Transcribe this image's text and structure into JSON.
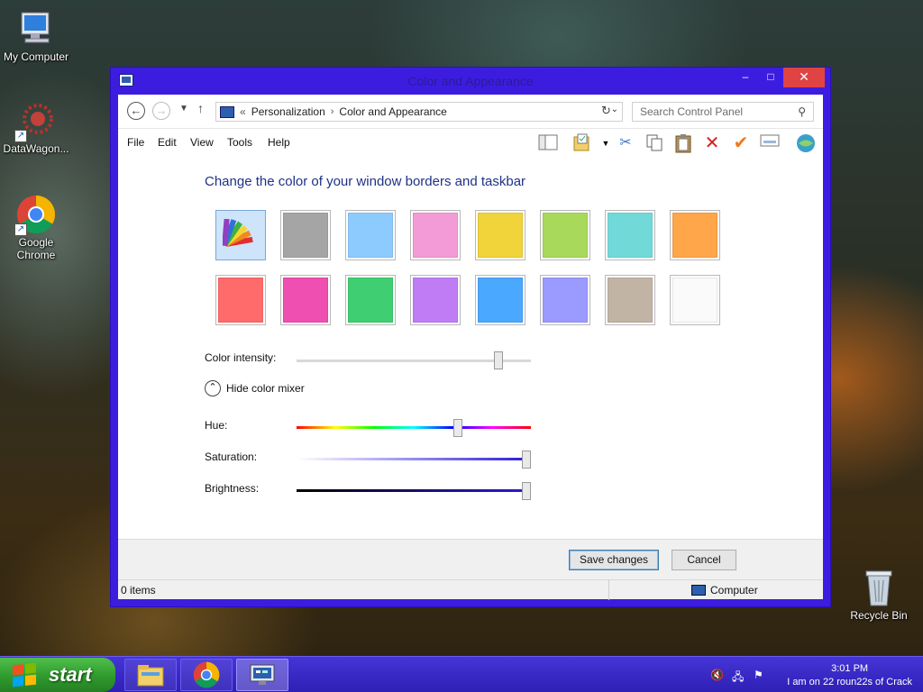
{
  "desktop": {
    "icons": [
      {
        "label": "My Computer",
        "icon": "my-computer-icon"
      },
      {
        "label": "DataWagon...",
        "icon": "datawagon-icon"
      },
      {
        "label": "Google Chrome",
        "icon": "chrome-icon"
      },
      {
        "label": "Recycle Bin",
        "icon": "recycle-bin-icon"
      }
    ]
  },
  "window": {
    "title": "Color and Appearance",
    "controls": {
      "minimize": "–",
      "maximize": "□",
      "close": "✕"
    },
    "address": {
      "breadcrumb_prefix": "«",
      "crumbs": [
        "Personalization",
        "Color and Appearance"
      ],
      "search_placeholder": "Search Control Panel"
    },
    "menu": [
      "File",
      "Edit",
      "View",
      "Tools",
      "Help"
    ],
    "heading": "Change the color of your window borders and taskbar",
    "swatches": {
      "row1": [
        "#palette",
        "#a5a5a5",
        "#8dcbff",
        "#f29bd6",
        "#f0d43a",
        "#a8d95a",
        "#72d9d9",
        "#ffa54a"
      ],
      "row2": [
        "#ff6b6b",
        "#ee4fb0",
        "#3fcf72",
        "#c07cf5",
        "#4aa8ff",
        "#9a9aff",
        "#c2b4a4",
        "#fafafa"
      ],
      "selected_index": 0
    },
    "intensity": {
      "label": "Color intensity:",
      "value_fraction": 0.86
    },
    "mixer": {
      "toggle_label": "Hide color mixer",
      "hue_label": "Hue:",
      "hue_fraction": 0.69,
      "saturation_label": "Saturation:",
      "saturation_fraction": 0.98,
      "brightness_label": "Brightness:",
      "brightness_fraction": 0.98
    },
    "buttons": {
      "save": "Save changes",
      "cancel": "Cancel"
    },
    "status": {
      "items": "0 items",
      "location": "Computer"
    }
  },
  "taskbar": {
    "start_label": "start",
    "time": "3:01 PM",
    "status_text": "I am on 22 roun22s of Crack"
  },
  "colors": {
    "window_frame": "#3c1de0",
    "taskbar": "#2e1fb5",
    "heading": "#1e3287",
    "start_green": "#2f9a2d"
  }
}
